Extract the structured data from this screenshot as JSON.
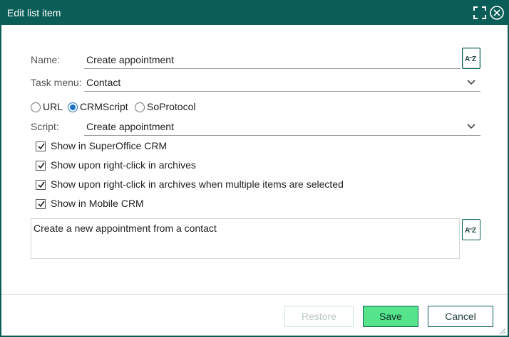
{
  "dialog": {
    "title": "Edit list item",
    "maximize_icon": "maximize-icon",
    "close_icon": "close-circle-icon"
  },
  "form": {
    "name_label": "Name:",
    "name_value": "Create appointment",
    "task_menu_label": "Task menu:",
    "task_menu_value": "Contact",
    "radios": [
      {
        "label": "URL",
        "checked": false
      },
      {
        "label": "CRMScript",
        "checked": true
      },
      {
        "label": "SoProtocol",
        "checked": false
      }
    ],
    "script_label": "Script:",
    "script_value": "Create appointment",
    "checkboxes": [
      {
        "label": "Show in SuperOffice CRM",
        "checked": true
      },
      {
        "label": "Show upon right-click in archives",
        "checked": true
      },
      {
        "label": "Show upon right-click in archives when multiple items are selected",
        "checked": true
      },
      {
        "label": "Show in Mobile CRM",
        "checked": true
      }
    ],
    "description": "Create a new appointment from a contact",
    "translate_button_text": "AZ"
  },
  "footer": {
    "restore_label": "Restore",
    "save_label": "Save",
    "cancel_label": "Cancel"
  },
  "colors": {
    "titlebar": "#0b5e57",
    "save_button": "#55e48c",
    "radio_checked": "#1a73c8"
  }
}
